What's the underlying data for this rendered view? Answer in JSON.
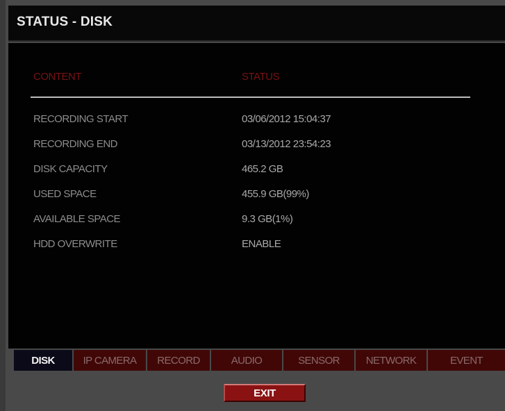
{
  "window": {
    "title": "STATUS - DISK"
  },
  "columns": {
    "content": "CONTENT",
    "status": "STATUS"
  },
  "rows": [
    {
      "label": "RECORDING START",
      "value": "03/06/2012 15:04:37"
    },
    {
      "label": "RECORDING END",
      "value": "03/13/2012 23:54:23"
    },
    {
      "label": "DISK CAPACITY",
      "value": "465.2 GB"
    },
    {
      "label": "USED SPACE",
      "value": "455.9 GB(99%)"
    },
    {
      "label": "AVAILABLE SPACE",
      "value": "9.3 GB(1%)"
    },
    {
      "label": "HDD OVERWRITE",
      "value": "ENABLE"
    }
  ],
  "tabs": [
    {
      "label": "DISK",
      "active": true
    },
    {
      "label": "IP CAMERA",
      "active": false
    },
    {
      "label": "RECORD",
      "active": false
    },
    {
      "label": "AUDIO",
      "active": false
    },
    {
      "label": "SENSOR",
      "active": false
    },
    {
      "label": "NETWORK",
      "active": false
    },
    {
      "label": "EVENT",
      "active": false
    }
  ],
  "buttons": {
    "exit": "EXIT"
  },
  "colors": {
    "header_red": "#7a1212",
    "tab_red": "#410707",
    "active_tab": "#0a0a18",
    "exit_red": "#8a1212"
  }
}
